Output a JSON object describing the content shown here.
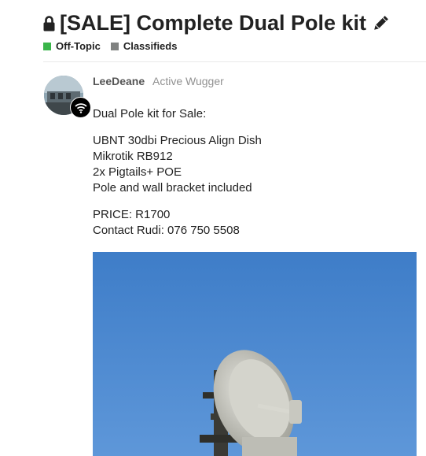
{
  "topic": {
    "title": "[SALE] Complete Dual Pole kit",
    "categories": [
      {
        "label": "Off-Topic",
        "color": "#3ab54a"
      },
      {
        "label": "Classifieds",
        "color": "#808281"
      }
    ]
  },
  "post": {
    "username": "LeeDeane",
    "user_title": "Active Wugger",
    "lines": {
      "intro": "Dual Pole kit for Sale:",
      "item1": "UBNT 30dbi Precious Align Dish",
      "item2": "Mikrotik RB912",
      "item3": "2x Pigtails+ POE",
      "item4": "Pole and wall bracket included",
      "price": "PRICE: R1700",
      "contact": "Contact Rudi: 076 750 5508"
    }
  },
  "icons": {
    "lock": "lock-icon",
    "edit": "pencil-icon",
    "badge": "wifi-icon"
  }
}
